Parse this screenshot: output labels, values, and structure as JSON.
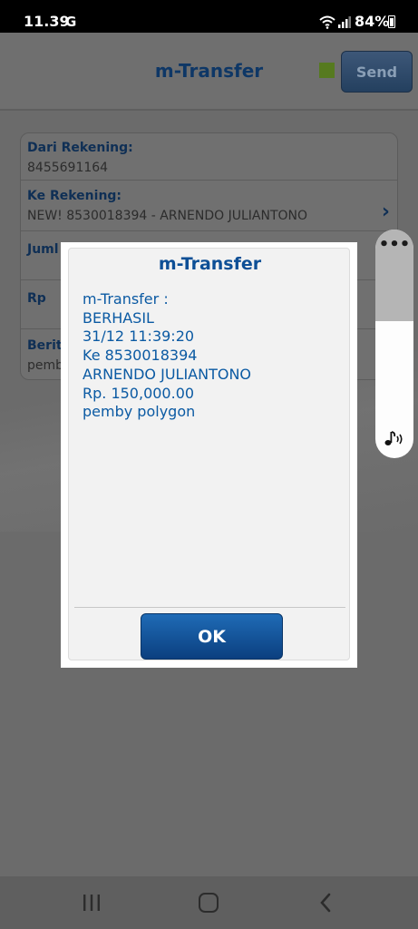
{
  "status_bar": {
    "time": "11.39",
    "carrier_icon_text": "G",
    "battery": "84%",
    "icons": [
      "wifi-icon",
      "signal-icon",
      "battery-icon"
    ]
  },
  "app": {
    "title": "m-Transfer",
    "send_label": "Send",
    "status_color": "#567a1f",
    "form": {
      "from_label": "Dari Rekening:",
      "from_value": "8455691164",
      "to_label": "Ke Rekening:",
      "to_value": "NEW! 8530018394 - ARNENDO JULIANTONO",
      "amount_label": "Juml",
      "currency_label": "Rp",
      "note_label": "Berit",
      "note_value": "pemb"
    }
  },
  "volume_panel": {
    "more_label": "•••",
    "level_percent": 60
  },
  "dialog": {
    "title": "m-Transfer",
    "lines": [
      "m-Transfer :",
      "BERHASIL",
      "31/12 11:39:20",
      "Ke 8530018394",
      "ARNENDO JULIANTONO",
      "Rp. 150,000.00",
      "pemby polygon"
    ],
    "ok_label": "OK"
  },
  "colors": {
    "accent": "#0d4f96",
    "overlay": "#6b6b6b",
    "button": "#0b3f7f"
  }
}
